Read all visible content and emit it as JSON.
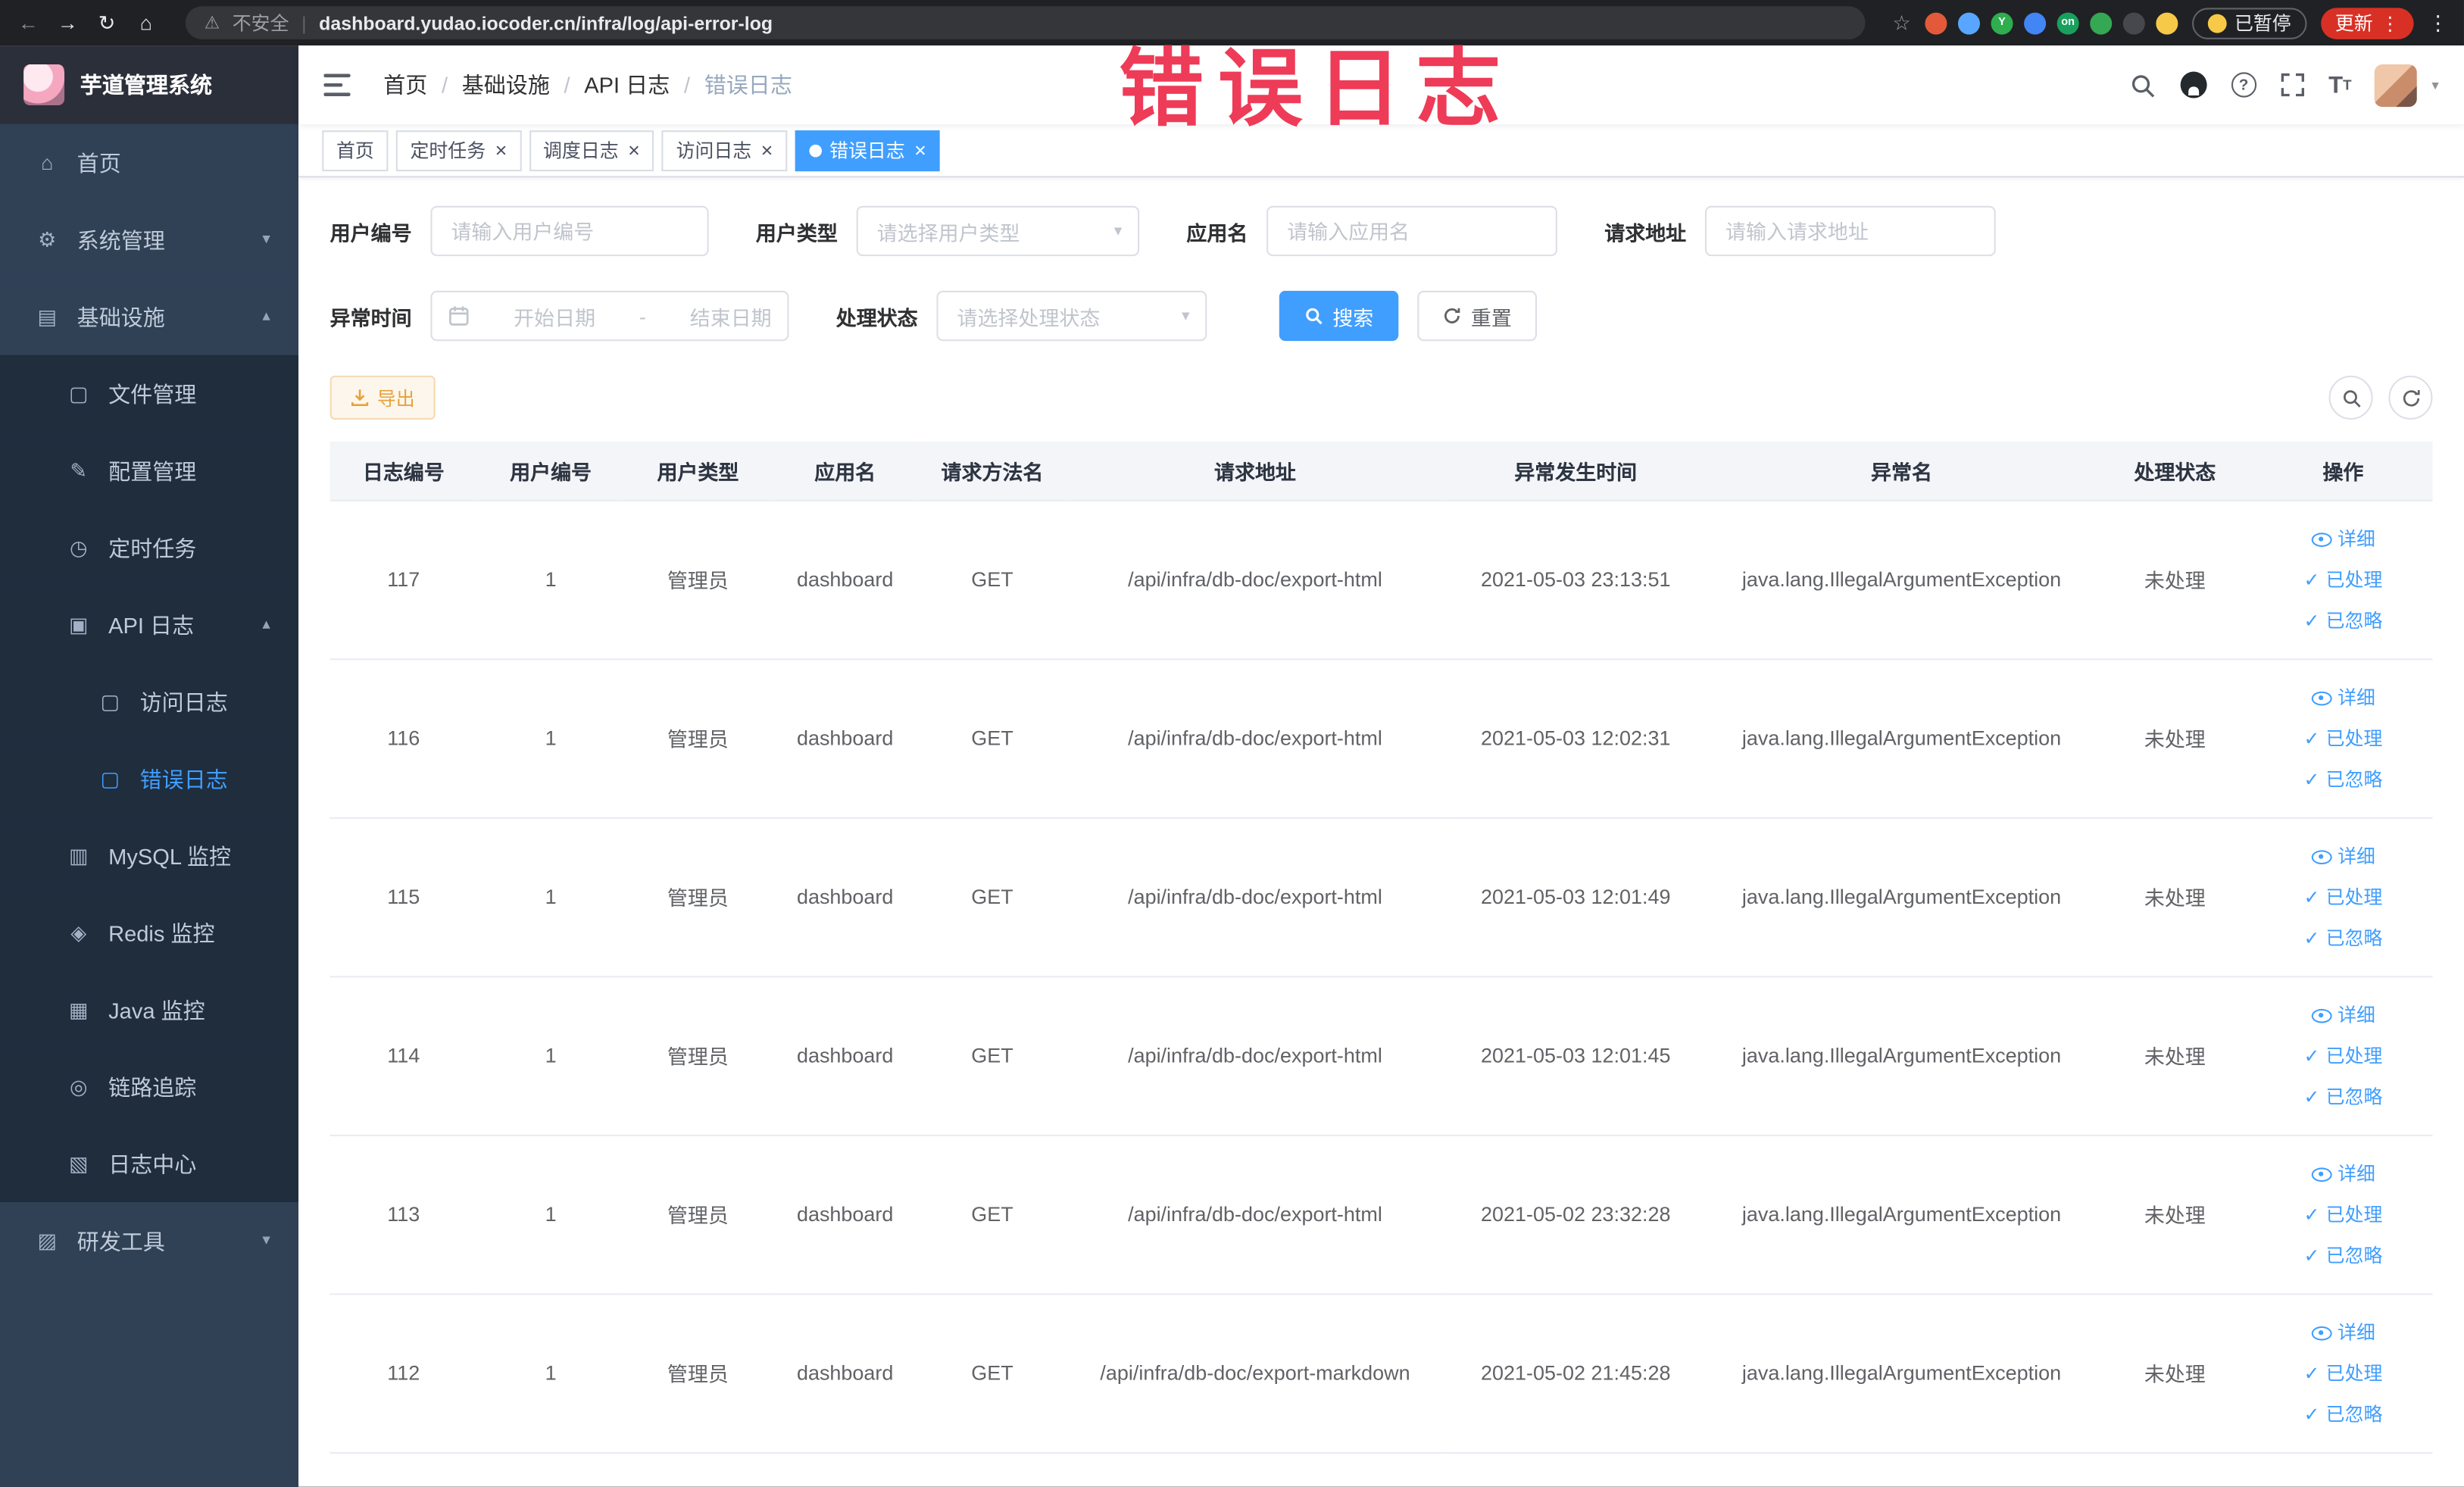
{
  "browser": {
    "security_label": "不安全",
    "url": "dashboard.yudao.iocoder.cn/infra/log/api-error-log",
    "paused_label": "已暂停",
    "update_label": "更新",
    "extensions": [
      {
        "name": "extension-red-icon",
        "color": "#e25a3a",
        "label": ""
      },
      {
        "name": "extension-blue-icon",
        "color": "#58a6ff",
        "label": ""
      },
      {
        "name": "extension-green-y-icon",
        "color": "#2eae4f",
        "label": "Y"
      },
      {
        "name": "extension-grid-blue-icon",
        "color": "#4285f4",
        "label": ""
      },
      {
        "name": "extension-on-badge-icon",
        "color": "#18a05d",
        "label": "on"
      },
      {
        "name": "extension-leaf-icon",
        "color": "#34a853",
        "label": ""
      },
      {
        "name": "extension-puzzle-icon",
        "color": "#46484d",
        "label": ""
      },
      {
        "name": "profile-emoji-icon",
        "color": "#f7c948",
        "label": ""
      }
    ]
  },
  "annotation": "错误日志",
  "sidebar": {
    "logo_title": "芋道管理系统",
    "items": [
      {
        "label": "首页",
        "icon": "home-icon",
        "level": 1
      },
      {
        "label": "系统管理",
        "icon": "gear-icon",
        "level": 1,
        "arrow": "down"
      },
      {
        "label": "基础设施",
        "icon": "infra-icon",
        "level": 1,
        "arrow": "up"
      },
      {
        "label": "文件管理",
        "icon": "file-icon",
        "level": 2
      },
      {
        "label": "配置管理",
        "icon": "config-icon",
        "level": 2
      },
      {
        "label": "定时任务",
        "icon": "timer-icon",
        "level": 2
      },
      {
        "label": "API 日志",
        "icon": "api-log-icon",
        "level": 2,
        "arrow": "up"
      },
      {
        "label": "访问日志",
        "icon": "doc-icon",
        "level": 3
      },
      {
        "label": "错误日志",
        "icon": "doc-icon",
        "level": 3,
        "active": true
      },
      {
        "label": "MySQL 监控",
        "icon": "mysql-icon",
        "level": 2
      },
      {
        "label": "Redis 监控",
        "icon": "redis-icon",
        "level": 2
      },
      {
        "label": "Java 监控",
        "icon": "java-icon",
        "level": 2
      },
      {
        "label": "链路追踪",
        "icon": "trace-icon",
        "level": 2
      },
      {
        "label": "日志中心",
        "icon": "log-center-icon",
        "level": 2
      },
      {
        "label": "研发工具",
        "icon": "tools-icon",
        "level": 1,
        "arrow": "down"
      }
    ]
  },
  "header": {
    "breadcrumb": [
      "首页",
      "基础设施",
      "API 日志",
      "错误日志"
    ]
  },
  "tabs": [
    {
      "label": "首页",
      "closable": false,
      "active": false
    },
    {
      "label": "定时任务",
      "closable": true,
      "active": false
    },
    {
      "label": "调度日志",
      "closable": true,
      "active": false
    },
    {
      "label": "访问日志",
      "closable": true,
      "active": false
    },
    {
      "label": "错误日志",
      "closable": true,
      "active": true
    }
  ],
  "filters": {
    "user_id": {
      "label": "用户编号",
      "placeholder": "请输入用户编号"
    },
    "user_type": {
      "label": "用户类型",
      "placeholder": "请选择用户类型"
    },
    "app_name": {
      "label": "应用名",
      "placeholder": "请输入应用名"
    },
    "request_url": {
      "label": "请求地址",
      "placeholder": "请输入请求地址"
    },
    "exception_time": {
      "label": "异常时间",
      "start_placeholder": "开始日期",
      "separator": "-",
      "end_placeholder": "结束日期"
    },
    "process_status": {
      "label": "处理状态",
      "placeholder": "请选择处理状态"
    },
    "search_label": "搜索",
    "reset_label": "重置"
  },
  "toolbar": {
    "export_label": "导出"
  },
  "table": {
    "columns": [
      "日志编号",
      "用户编号",
      "用户类型",
      "应用名",
      "请求方法名",
      "请求地址",
      "异常发生时间",
      "异常名",
      "处理状态",
      "操作"
    ],
    "actions": {
      "detail": "详细",
      "processed": "已处理",
      "ignored": "已忽略"
    },
    "rows": [
      {
        "id": "117",
        "user_id": "1",
        "user_type": "管理员",
        "app": "dashboard",
        "method": "GET",
        "url": "/api/infra/db-doc/export-html",
        "time": "2021-05-03 23:13:51",
        "exception": "java.lang.IllegalArgumentException",
        "status": "未处理"
      },
      {
        "id": "116",
        "user_id": "1",
        "user_type": "管理员",
        "app": "dashboard",
        "method": "GET",
        "url": "/api/infra/db-doc/export-html",
        "time": "2021-05-03 12:02:31",
        "exception": "java.lang.IllegalArgumentException",
        "status": "未处理"
      },
      {
        "id": "115",
        "user_id": "1",
        "user_type": "管理员",
        "app": "dashboard",
        "method": "GET",
        "url": "/api/infra/db-doc/export-html",
        "time": "2021-05-03 12:01:49",
        "exception": "java.lang.IllegalArgumentException",
        "status": "未处理"
      },
      {
        "id": "114",
        "user_id": "1",
        "user_type": "管理员",
        "app": "dashboard",
        "method": "GET",
        "url": "/api/infra/db-doc/export-html",
        "time": "2021-05-03 12:01:45",
        "exception": "java.lang.IllegalArgumentException",
        "status": "未处理"
      },
      {
        "id": "113",
        "user_id": "1",
        "user_type": "管理员",
        "app": "dashboard",
        "method": "GET",
        "url": "/api/infra/db-doc/export-html",
        "time": "2021-05-02 23:32:28",
        "exception": "java.lang.IllegalArgumentException",
        "status": "未处理"
      },
      {
        "id": "112",
        "user_id": "1",
        "user_type": "管理员",
        "app": "dashboard",
        "method": "GET",
        "url": "/api/infra/db-doc/export-markdown",
        "time": "2021-05-02 21:45:28",
        "exception": "java.lang.IllegalArgumentException",
        "status": "未处理"
      }
    ]
  },
  "colors": {
    "accent": "#409EFF",
    "sidebar_bg": "#304156",
    "submenu_bg": "#1f2d3d",
    "warning": "#e6a23c",
    "annotation_red": "#ee3b57"
  }
}
